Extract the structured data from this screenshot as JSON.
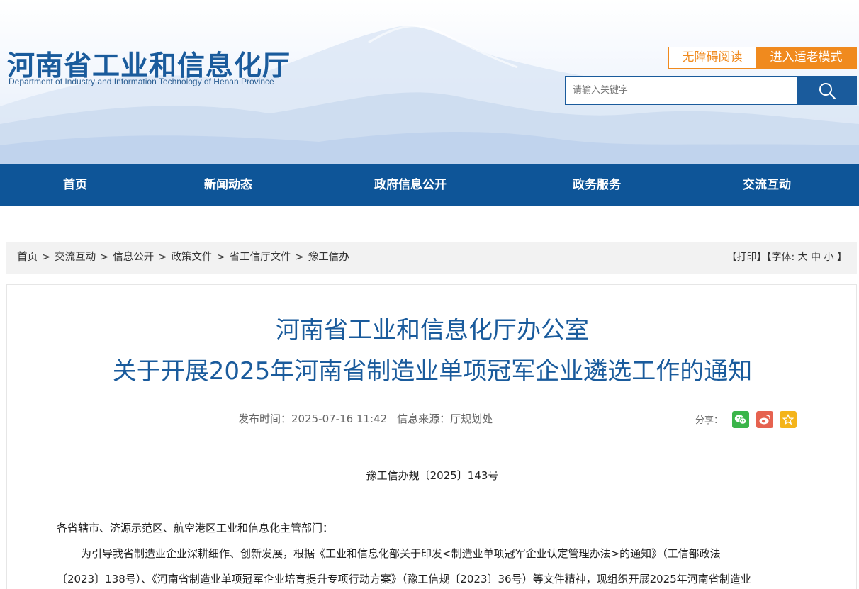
{
  "header": {
    "title": "河南省工业和信息化厅",
    "subtitle": "Department of Industry and Information Technology of Henan Province",
    "accessible_label": "无障碍阅读",
    "elder_mode_label": "进入适老模式",
    "search_placeholder": "请输入关键字",
    "search_icon": "search-icon"
  },
  "nav": {
    "items": [
      {
        "label": "首页"
      },
      {
        "label": "新闻动态"
      },
      {
        "label": "政府信息公开"
      },
      {
        "label": "政务服务"
      },
      {
        "label": "交流互动"
      }
    ]
  },
  "breadcrumb": {
    "items": [
      "首页",
      "交流互动",
      "信息公开",
      "政策文件",
      "省工信厅文件",
      "豫工信办"
    ],
    "separator": ">",
    "print": "【打印】",
    "font_label": "【字体:",
    "font_large": "大",
    "font_medium": "中",
    "font_small": "小",
    "font_close": "】"
  },
  "article": {
    "title_line1": "河南省工业和信息化厅办公室",
    "title_line2": "关于开展2025年河南省制造业单项冠军企业遴选工作的通知",
    "publish_time": "发布时间：2025-07-16 11:42",
    "source": "信息来源：厅规划处",
    "share_label": "分享：",
    "share_icons": [
      "wechat-icon",
      "weibo-icon",
      "favorite-icon"
    ],
    "doc_number": "豫工信办规〔2025〕143号",
    "paragraphs": [
      "各省辖市、济源示范区、航空港区工业和信息化主管部门：",
      "为引导我省制造业企业深耕细作、创新发展，根据《工业和信息化部关于印发<制造业单项冠军企业认定管理办法>的通知》（工信部政法",
      "〔2023〕138号）、《河南省制造业单项冠军企业培育提升专项行动方案》（豫工信规〔2023〕36号）等文件精神，现组织开展2025年河南省制造业"
    ]
  },
  "colors": {
    "brand_blue": "#1a5b9c",
    "nav_blue": "#0e5598",
    "accent_orange": "#f08a1e"
  }
}
